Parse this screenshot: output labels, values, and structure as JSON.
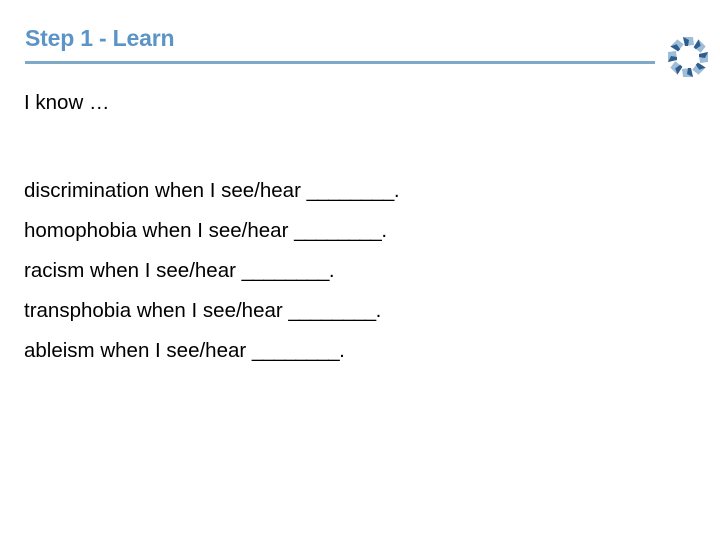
{
  "slide": {
    "title": "Step 1 - Learn",
    "lead": "I know …",
    "decoration_name": "rosette-logo",
    "colors": {
      "title": "#5b94c6",
      "rule": "#7fa9c8",
      "body_text": "#000000",
      "background": "#ffffff",
      "deco_light": "#a8c4dd",
      "deco_dark": "#2e5d8c"
    },
    "lines": [
      {
        "prefix": "discrimination when I see/hear",
        "blank": "________",
        "suffix": "."
      },
      {
        "prefix": "homophobia when I see/hear",
        "blank": "________",
        "suffix": "."
      },
      {
        "prefix": "racism when I see/hear",
        "blank": "________",
        "suffix": "."
      },
      {
        "prefix": "transphobia when I see/hear",
        "blank": "________",
        "suffix": "."
      },
      {
        "prefix": "ableism when I see/hear",
        "blank": "________",
        "suffix": "."
      }
    ]
  }
}
